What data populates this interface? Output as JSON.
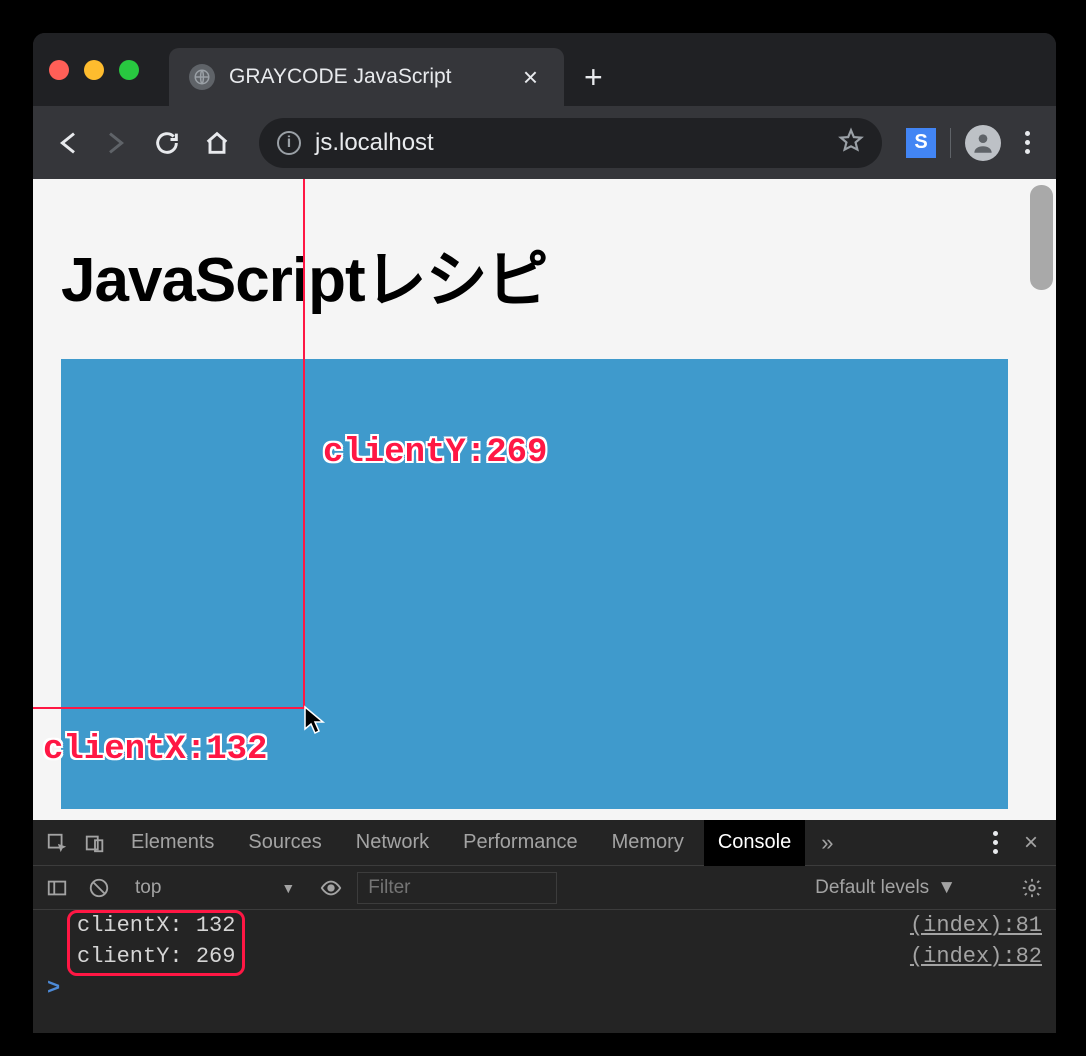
{
  "tab": {
    "title": "GRAYCODE JavaScript",
    "close_label": "×",
    "new_tab_label": "+"
  },
  "url": "js.localhost",
  "ext_letter": "S",
  "page": {
    "heading": "JavaScriptレシピ"
  },
  "annotations": {
    "clientY": "clientY:269",
    "clientX": "clientX:132"
  },
  "devtools": {
    "tabs": [
      "Elements",
      "Sources",
      "Network",
      "Performance",
      "Memory",
      "Console"
    ],
    "active_tab": "Console",
    "more": "»",
    "close": "×",
    "context": "top",
    "filter_placeholder": "Filter",
    "levels": "Default levels",
    "rows": [
      {
        "text": "clientX: 132",
        "src": "(index):81"
      },
      {
        "text": "clientY: 269",
        "src": "(index):82"
      }
    ],
    "prompt": ">"
  }
}
